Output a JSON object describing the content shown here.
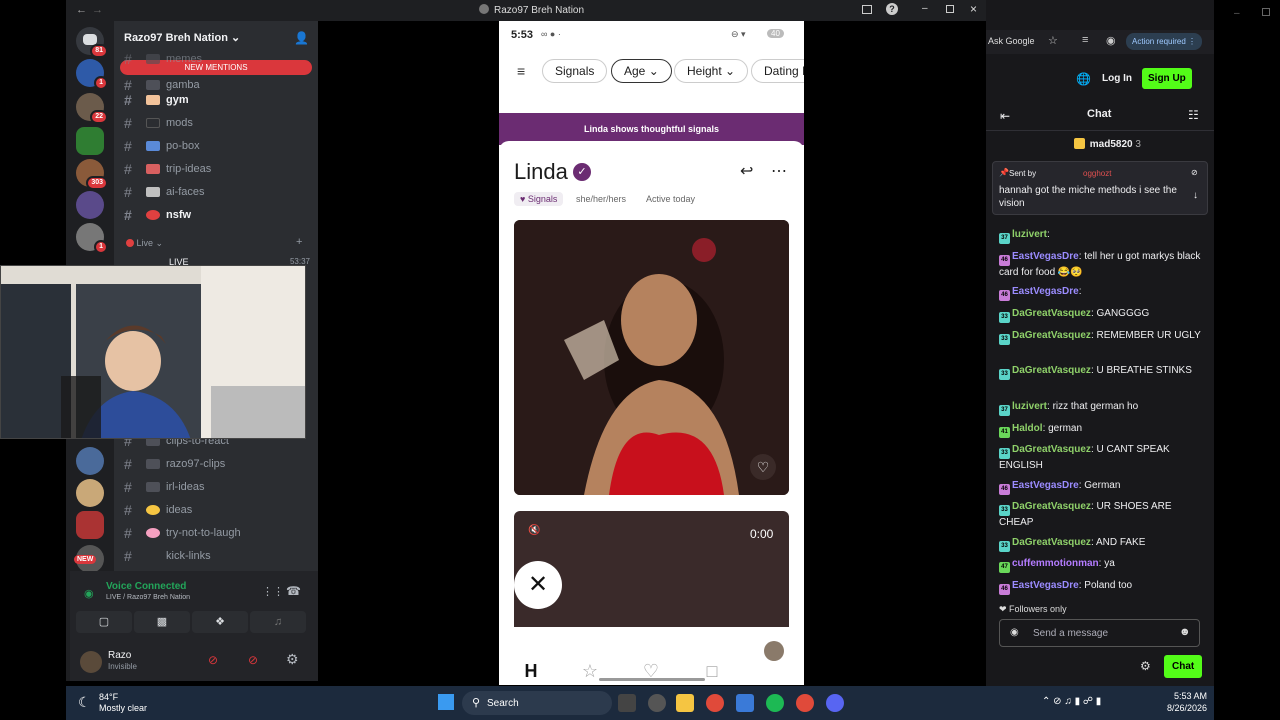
{
  "window": {
    "title": "Razo97 Breh Nation"
  },
  "server": {
    "name": "Razo97 Breh Nation",
    "new_mentions": "NEW MENTIONS"
  },
  "server_badges": [
    "81",
    "1",
    "22",
    "303",
    "1"
  ],
  "new_label": "NEW",
  "channels_top": [
    {
      "name": "memes",
      "bold": false
    },
    {
      "name": "gamba",
      "bold": false
    },
    {
      "name": "gym",
      "bold": true
    },
    {
      "name": "mods",
      "bold": false
    },
    {
      "name": "po-box",
      "bold": false
    },
    {
      "name": "trip-ideas",
      "bold": false
    },
    {
      "name": "ai-faces",
      "bold": false
    },
    {
      "name": "nsfw",
      "bold": true
    }
  ],
  "live_category": "Live",
  "live_channel": {
    "name": "LIVE",
    "time": "53:37"
  },
  "channels_bottom": [
    {
      "name": "clips-to-react"
    },
    {
      "name": "razo97-clips"
    },
    {
      "name": "irl-ideas"
    },
    {
      "name": "ideas"
    },
    {
      "name": "try-not-to-laugh"
    },
    {
      "name": "kick-links"
    }
  ],
  "voice": {
    "status": "Voice Connected",
    "location": "LIVE / Razo97 Breh Nation"
  },
  "user": {
    "name": "Razo",
    "status": "Invisible"
  },
  "phone": {
    "time": "5:53",
    "battery": "40",
    "filters": [
      "Signals",
      "Age",
      "Height",
      "Dating In"
    ],
    "banner": "Linda shows thoughtful signals",
    "profile_name": "Linda",
    "tags": [
      "Signals",
      "she/her/hers",
      "Active today"
    ],
    "video_time": "0:00"
  },
  "chat": {
    "top_buttons": {
      "ask_google": "Ask Google",
      "action_required": "Action required"
    },
    "login": "Log In",
    "signup": "Sign Up",
    "title": "Chat",
    "leader": {
      "name": "mad5820",
      "count": "3"
    },
    "pinned": {
      "sent_by": "Sent by",
      "sender": "ogghozt",
      "text": "hannah got the miche methods i see the vision"
    },
    "messages": [
      {
        "user": "luzivert",
        "color": "#8fd16a",
        "text": ":"
      },
      {
        "user": "EastVegasDre",
        "color": "#9b8cff",
        "text": ": tell her u got markys black card for food 😂🥺"
      },
      {
        "user": "EastVegasDre",
        "color": "#9b8cff",
        "text": ":"
      },
      {
        "user": "DaGreatVasquez",
        "color": "#8fd16a",
        "text": ": GANGGGG"
      },
      {
        "user": "DaGreatVasquez",
        "color": "#8fd16a",
        "text": ": REMEMBER UR UGLY"
      },
      {
        "user": "DaGreatVasquez",
        "color": "#8fd16a",
        "text": ": U BREATHE STINKS"
      },
      {
        "user": "luzivert",
        "color": "#8fd16a",
        "text": ": rizz that german ho"
      },
      {
        "user": "Haldol",
        "color": "#8fd16a",
        "text": ": german"
      },
      {
        "user": "DaGreatVasquez",
        "color": "#8fd16a",
        "text": ": U CANT SPEAK ENGLISH"
      },
      {
        "user": "EastVegasDre",
        "color": "#9b8cff",
        "text": ": German"
      },
      {
        "user": "DaGreatVasquez",
        "color": "#8fd16a",
        "text": ": UR SHOES ARE CHEAP"
      },
      {
        "user": "DaGreatVasquez",
        "color": "#8fd16a",
        "text": ": AND FAKE"
      },
      {
        "user": "cuffemmotionman",
        "color": "#b47cff",
        "text": ": ya"
      },
      {
        "user": "EastVegasDre",
        "color": "#9b8cff",
        "text": ": Poland too"
      }
    ],
    "badge_numbers": [
      "37",
      "46",
      "46",
      "33",
      "33",
      "33",
      "37",
      "41",
      "33",
      "46",
      "33",
      "33",
      "47",
      "46"
    ],
    "followers_only": "Followers only",
    "placeholder": "Send a message",
    "chat_button": "Chat"
  },
  "taskbar": {
    "weather_temp": "84°F",
    "weather_desc": "Mostly clear",
    "search": "Search",
    "time": "5:53 AM",
    "date": "8/26/2026"
  },
  "colors": {
    "discord_bg": "#2b2d31",
    "twitch_purple": "#a970ff",
    "signup_green": "#53fc18",
    "hinge_purple": "#6b2c72"
  }
}
